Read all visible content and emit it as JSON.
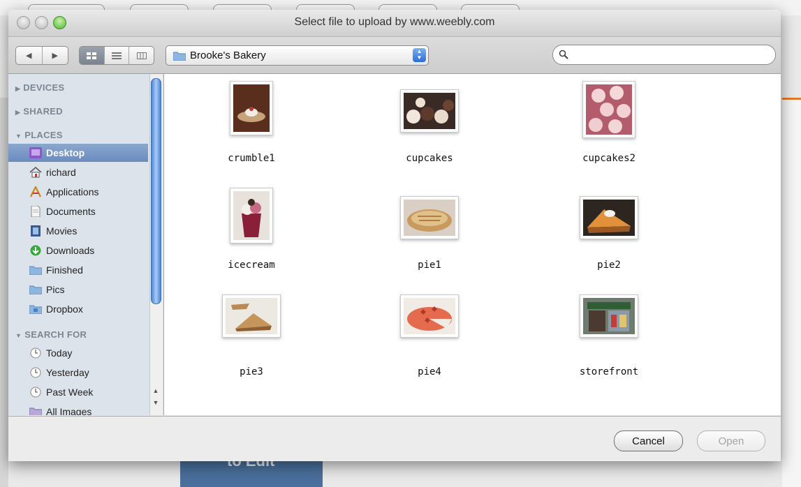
{
  "window": {
    "title": "Select file to upload by www.weebly.com"
  },
  "toolbar": {
    "location": "Brooke's Bakery",
    "search": {
      "value": "",
      "placeholder": ""
    }
  },
  "sidebar": {
    "devices_label": "DEVICES",
    "shared_label": "SHARED",
    "places_label": "PLACES",
    "search_for_label": "SEARCH FOR",
    "places": [
      {
        "label": "Desktop",
        "icon": "desktop-icon",
        "selected": true
      },
      {
        "label": "richard",
        "icon": "home-icon"
      },
      {
        "label": "Applications",
        "icon": "applications-icon"
      },
      {
        "label": "Documents",
        "icon": "documents-icon"
      },
      {
        "label": "Movies",
        "icon": "movies-icon"
      },
      {
        "label": "Downloads",
        "icon": "downloads-icon"
      },
      {
        "label": "Finished",
        "icon": "folder-icon"
      },
      {
        "label": "Pics",
        "icon": "folder-icon"
      },
      {
        "label": "Dropbox",
        "icon": "dropbox-folder-icon"
      }
    ],
    "search_for": [
      {
        "label": "Today",
        "icon": "clock-icon"
      },
      {
        "label": "Yesterday",
        "icon": "clock-icon"
      },
      {
        "label": "Past Week",
        "icon": "clock-icon"
      },
      {
        "label": "All Images",
        "icon": "images-folder-icon"
      }
    ]
  },
  "files": [
    {
      "name": "crumble1"
    },
    {
      "name": "cupcakes"
    },
    {
      "name": "cupcakes2"
    },
    {
      "name": "icecream"
    },
    {
      "name": "pie1"
    },
    {
      "name": "pie2"
    },
    {
      "name": "pie3"
    },
    {
      "name": "pie4"
    },
    {
      "name": "storefront"
    }
  ],
  "buttons": {
    "cancel": "Cancel",
    "open": "Open"
  },
  "background": {
    "edit_text": "to Edit"
  },
  "colors": {
    "selection": "#7596c6",
    "section_header": "#7c8794",
    "scroll_thumb": "#4d86d9",
    "zoom_button": "#4fb634"
  }
}
